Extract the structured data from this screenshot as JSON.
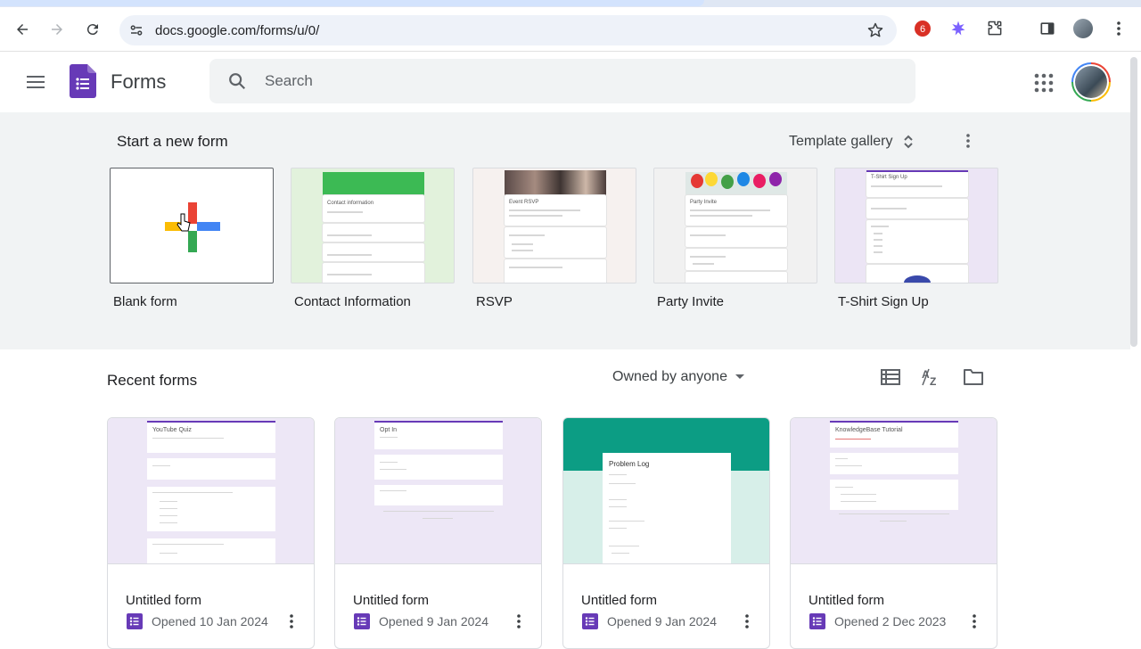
{
  "browser": {
    "url": "docs.google.com/forms/u/0/",
    "extension_badge": "6",
    "nav_icons": [
      "back-icon",
      "forward-icon",
      "reload-icon"
    ],
    "accent": "#673ab7"
  },
  "appbar": {
    "title": "Forms",
    "search_placeholder": "Search"
  },
  "new_form": {
    "heading": "Start a new form",
    "template_gallery_label": "Template gallery",
    "templates": [
      {
        "label": "Blank form",
        "preview_title": ""
      },
      {
        "label": "Contact Information",
        "preview_title": "Contact information"
      },
      {
        "label": "RSVP",
        "preview_title": "Event RSVP"
      },
      {
        "label": "Party Invite",
        "preview_title": "Party Invite"
      },
      {
        "label": "T-Shirt Sign Up",
        "preview_title": "T-Shirt Sign Up"
      }
    ]
  },
  "recent": {
    "heading": "Recent forms",
    "owner_filter": "Owned by anyone",
    "forms": [
      {
        "name": "Untitled form",
        "opened": "Opened 10 Jan 2024",
        "preview_title": "YouTube Quiz"
      },
      {
        "name": "Untitled form",
        "opened": "Opened 9 Jan 2024",
        "preview_title": "Opt In"
      },
      {
        "name": "Untitled form",
        "opened": "Opened 9 Jan 2024",
        "preview_title": "Problem Log"
      },
      {
        "name": "Untitled form",
        "opened": "Opened 2 Dec 2023",
        "preview_title": "KnowledgeBase Tutorial"
      }
    ]
  }
}
